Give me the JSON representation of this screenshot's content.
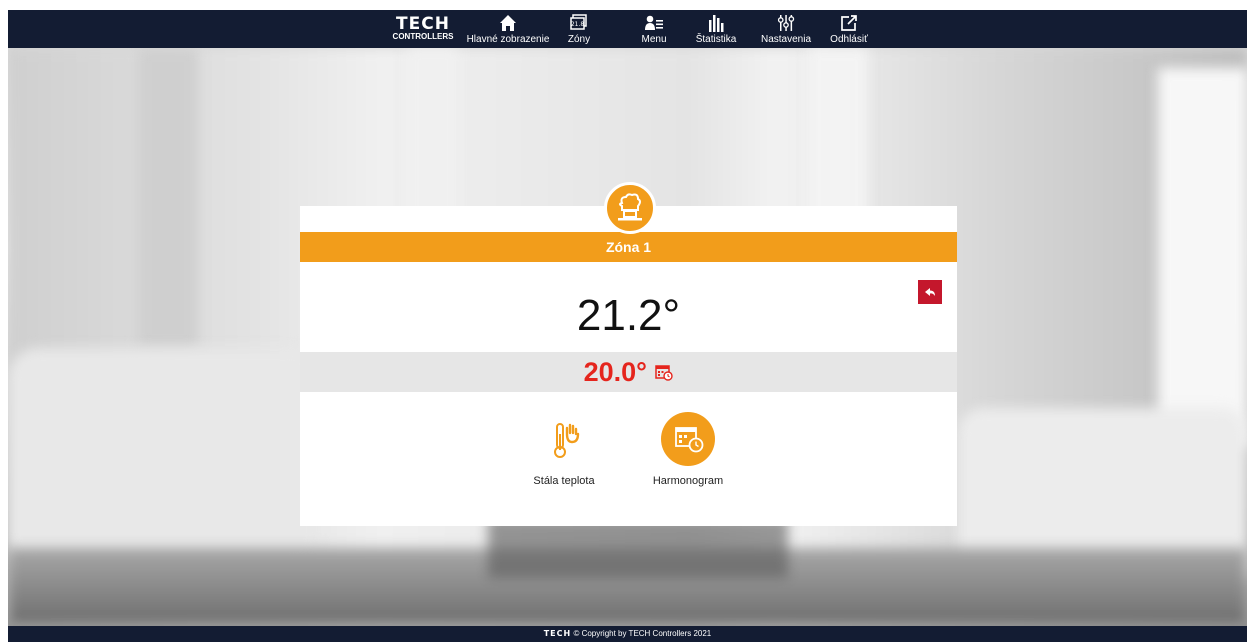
{
  "brand": {
    "name": "TECH",
    "sub": "CONTROLLERS"
  },
  "nav": [
    {
      "label": "Hlavné zobrazenie",
      "icon": "home-icon"
    },
    {
      "label": "Zóny",
      "icon": "zones-icon",
      "badge": "21.8"
    },
    {
      "label": "Menu",
      "icon": "menu-icon"
    },
    {
      "label": "Štatistika",
      "icon": "statistics-icon"
    },
    {
      "label": "Nastavenia",
      "icon": "settings-icon"
    },
    {
      "label": "Odhlásiť",
      "icon": "logout-icon"
    }
  ],
  "zone": {
    "name": "Zóna 1",
    "current_temp": "21.2°",
    "set_temp": "20.0°",
    "zone_icon": "kitchen-icon",
    "back_icon": "back-arrow-icon"
  },
  "modes": [
    {
      "label": "Stála teplota",
      "icon": "thermometer-hand-icon",
      "active": false
    },
    {
      "label": "Harmonogram",
      "icon": "calendar-clock-icon",
      "active": true
    }
  ],
  "footer": {
    "brand": "TECH",
    "text": "© Copyright by TECH Controllers 2021"
  },
  "colors": {
    "accent": "#f29d1b",
    "navbar": "#131c33",
    "set_temp": "#e5251d",
    "back": "#c4172c"
  }
}
